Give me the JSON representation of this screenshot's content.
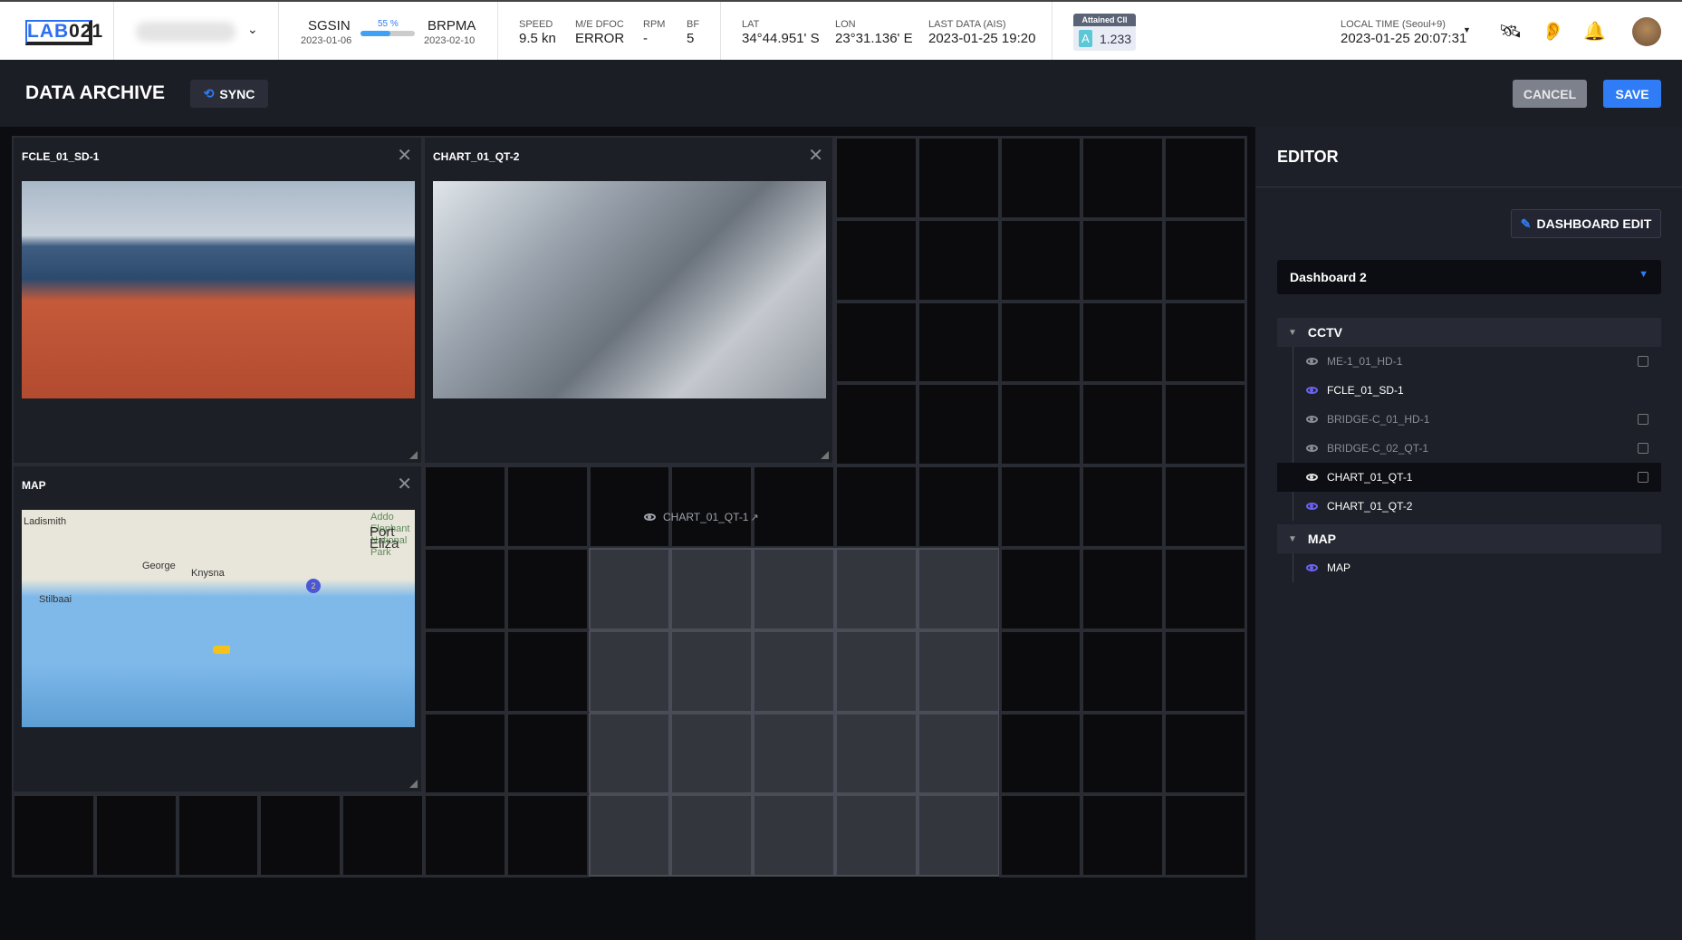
{
  "header": {
    "logo": "LAB021",
    "route": {
      "from": "SGSIN",
      "from_date": "2023-01-06",
      "to": "BRPMA",
      "to_date": "2023-02-10",
      "progress_label": "55 %",
      "progress": 55
    },
    "stats": [
      {
        "label": "SPEED",
        "value": "9.5 kn"
      },
      {
        "label": "M/E DFOC",
        "value": "ERROR"
      },
      {
        "label": "RPM",
        "value": "-"
      },
      {
        "label": "BF",
        "value": "5"
      }
    ],
    "position": [
      {
        "label": "LAT",
        "value": "34°44.951' S"
      },
      {
        "label": "LON",
        "value": "23°31.136' E"
      },
      {
        "label": "LAST DATA (AIS)",
        "value": "2023-01-25 19:20"
      }
    ],
    "cii": {
      "label": "Attained CII",
      "grade": "A",
      "value": "1.233"
    },
    "local_time": {
      "label": "LOCAL TIME (Seoul+9)",
      "value": "2023-01-25 20:07:31"
    }
  },
  "titlebar": {
    "title": "DATA ARCHIVE",
    "sync": "SYNC",
    "cancel": "CANCEL",
    "save": "SAVE"
  },
  "panels": [
    {
      "title": "FCLE_01_SD-1"
    },
    {
      "title": "CHART_01_QT-2"
    },
    {
      "title": "MAP",
      "labels": [
        "Ladismith",
        "George",
        "Knysna",
        "Stilbaai",
        "Addo Elephant National Park",
        "Port Eliza",
        "2"
      ]
    }
  ],
  "drag_ghost": "CHART_01_QT-1",
  "editor": {
    "title": "EDITOR",
    "dashboard_edit": "DASHBOARD EDIT",
    "dashboard_select": "Dashboard 2",
    "groups": [
      {
        "name": "CCTV",
        "items": [
          {
            "label": "ME-1_01_HD-1",
            "active": false
          },
          {
            "label": "FCLE_01_SD-1",
            "active": true
          },
          {
            "label": "BRIDGE-C_01_HD-1",
            "active": false
          },
          {
            "label": "BRIDGE-C_02_QT-1",
            "active": false
          },
          {
            "label": "CHART_01_QT-1",
            "active": false,
            "selected": true
          },
          {
            "label": "CHART_01_QT-2",
            "active": true
          }
        ]
      },
      {
        "name": "MAP",
        "items": [
          {
            "label": "MAP",
            "active": true
          }
        ]
      }
    ]
  },
  "colors": {
    "accent": "#2f7cf6",
    "active_eye": "#6b63f0",
    "inactive_text": "#8a8d96"
  }
}
